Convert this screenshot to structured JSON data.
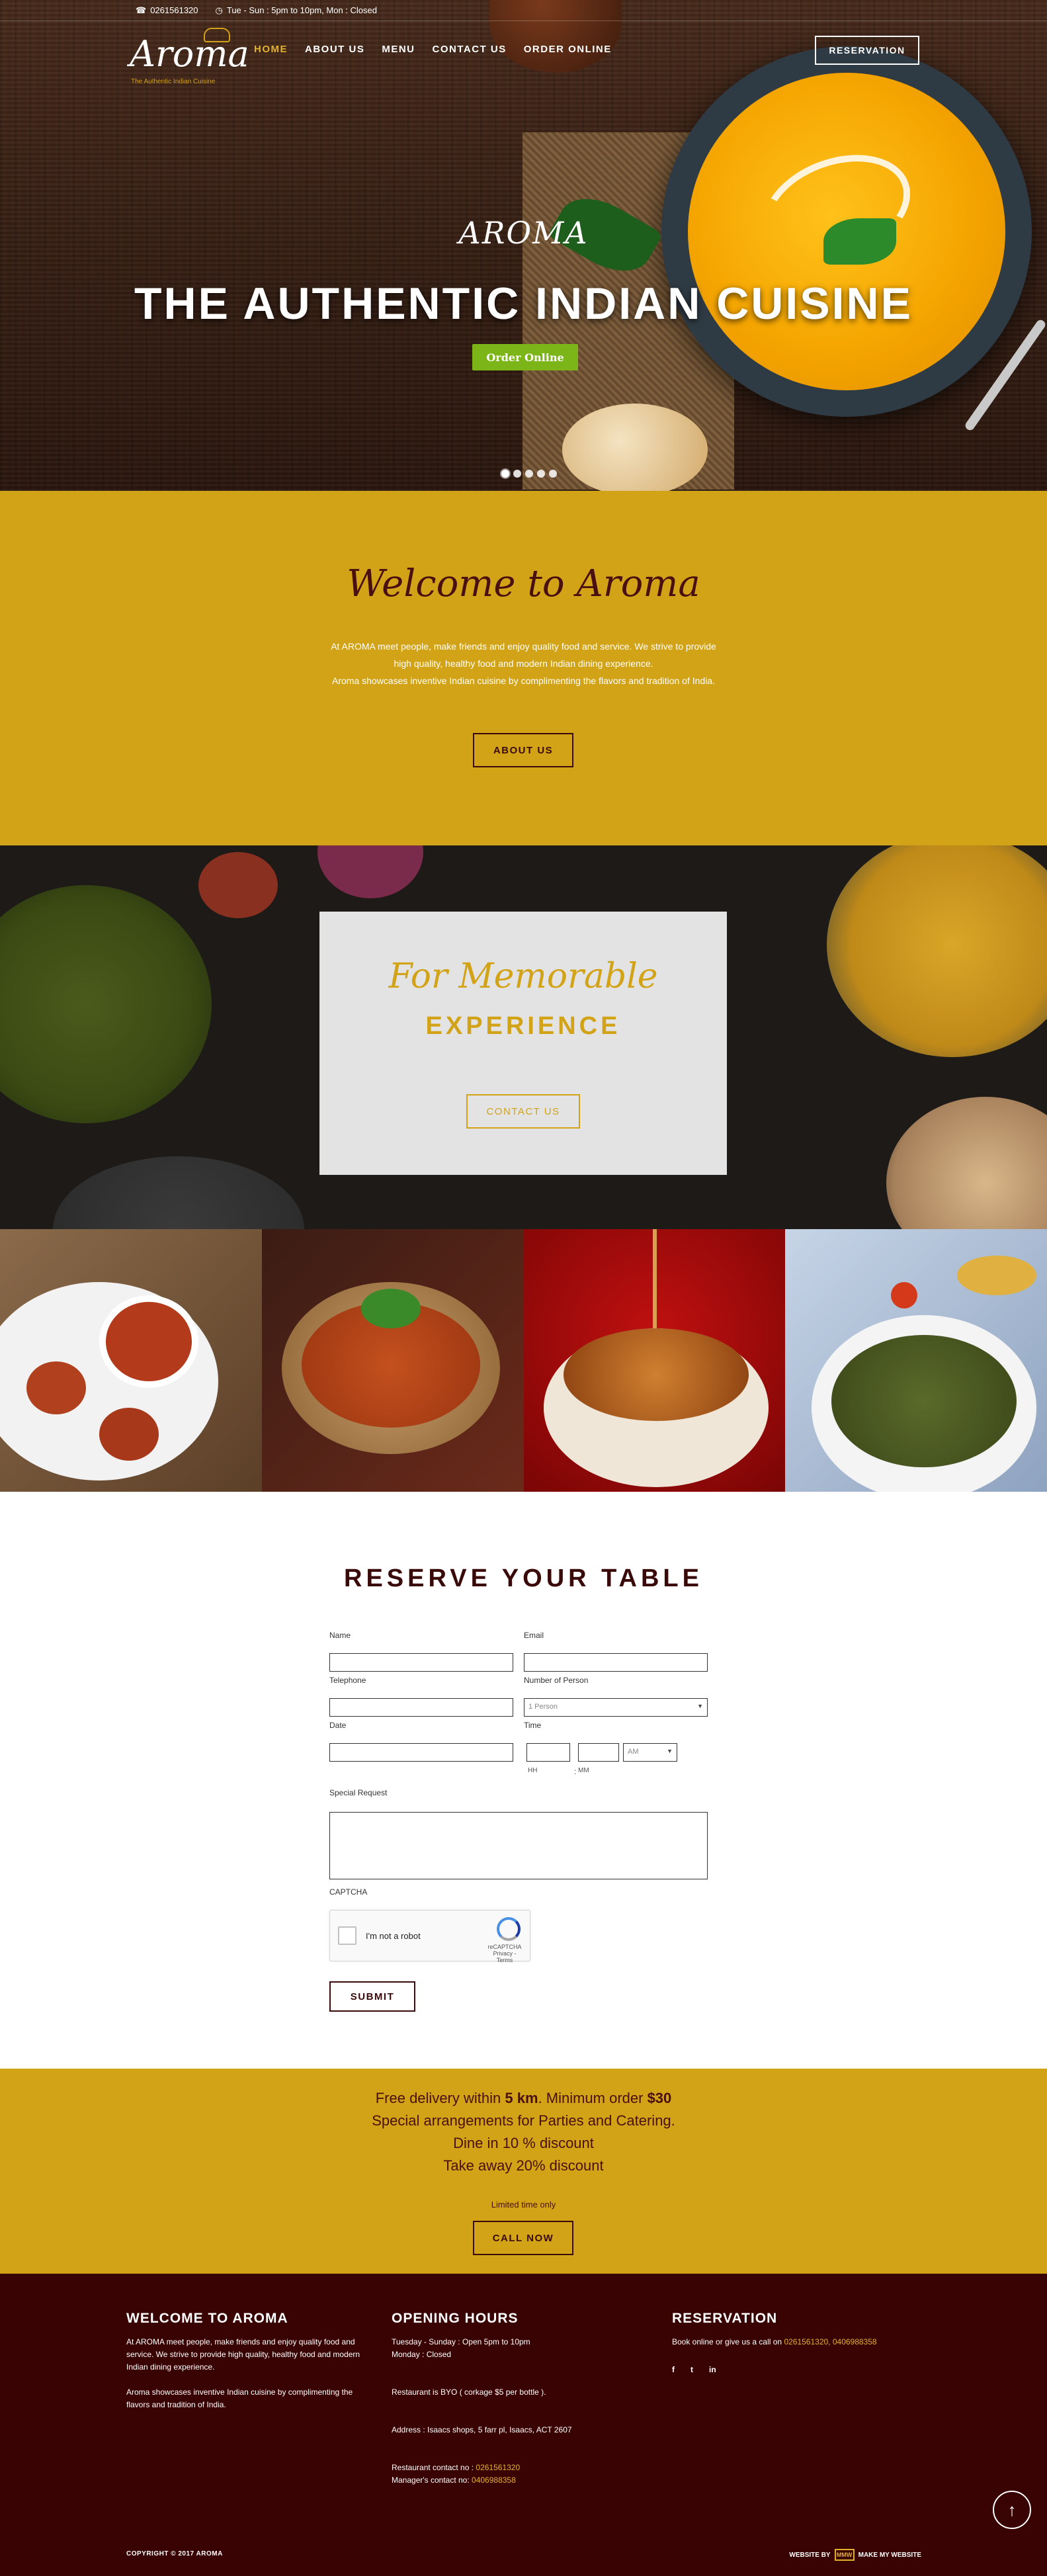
{
  "topbar": {
    "phone": "0261561320",
    "hours": "Tue - Sun : 5pm to 10pm, Mon : Closed"
  },
  "logo": {
    "text": "Aroma",
    "tagline": "The Authentic Indian Cuisine"
  },
  "nav": {
    "items": [
      "HOME",
      "ABOUT US",
      "MENU",
      "CONTACT US",
      "ORDER ONLINE"
    ],
    "reservation": "RESERVATION"
  },
  "hero": {
    "subtitle": "AROMA",
    "title": "THE AUTHENTIC INDIAN CUISINE",
    "cta": "Order Online",
    "slides": 5,
    "active_slide": 1
  },
  "welcome": {
    "title": "Welcome to Aroma",
    "para1": "At AROMA meet people, make friends and enjoy quality food and service. We strive to provide high quality, healthy food and modern Indian dining experience.",
    "para2": "Aroma showcases inventive Indian cuisine by complimenting the flavors and tradition of India.",
    "button": "ABOUT US"
  },
  "memorable": {
    "script": "For Memorable",
    "caps": "EXPERIENCE",
    "button": "CONTACT US"
  },
  "reserve": {
    "title": "RESERVE YOUR TABLE",
    "name_label": "Name",
    "email_label": "Email",
    "telephone_label": "Telephone",
    "persons_label": "Number of Person",
    "persons_value": "1 Person",
    "date_label": "Date",
    "time_label": "Time",
    "hh": "HH",
    "mm": "MM",
    "colon": ":",
    "ampm": "AM",
    "request_label": "Special Request",
    "captcha_label": "CAPTCHA",
    "captcha_text": "I'm not a robot",
    "recaptcha": "reCAPTCHA",
    "recaptcha_links": "Privacy - Terms",
    "submit": "SUBMIT"
  },
  "promo": {
    "l1_pre": "Free delivery within ",
    "l1_b1": "5 km",
    "l1_mid": ". Minimum order ",
    "l1_b2": "$30",
    "l2": "Special arrangements for Parties and Catering.",
    "l3": "Dine in 10 % discount",
    "l4": "Take away 20% discount",
    "note": "Limited time only",
    "button": "CALL NOW"
  },
  "footer": {
    "c1_title": "WELCOME TO AROMA",
    "c1_p1": "At AROMA meet people, make friends and enjoy quality food and service. We strive to provide high quality, healthy food and modern Indian dining experience.",
    "c1_p2": "Aroma showcases inventive Indian cuisine by complimenting the flavors and tradition of India.",
    "c2_title": "OPENING HOURS",
    "c2_l1": "Tuesday - Sunday : Open 5pm to 10pm",
    "c2_l2": "Monday : Closed",
    "c2_l3": "Restaurant is BYO ( corkage $5 per bottle ).",
    "c2_addr": "Address : Isaacs shops, 5 farr pl, Isaacs, ACT 2607",
    "c2_contact_label": "Restaurant contact no : ",
    "c2_contact": "0261561320",
    "c2_manager_label": "Manager's contact no: ",
    "c2_manager": "0406988358",
    "c3_title": "RESERVATION",
    "c3_text": "Book online or give us a call on ",
    "c3_phones": "0261561320, 0406988358",
    "social": [
      "f",
      "t",
      "in"
    ],
    "copyright": "COPYRIGHT © 2017 AROMA",
    "credit_pre": "WEBSITE BY",
    "credit_logo": "MMW",
    "credit_post": "MAKE MY WEBSITE"
  },
  "colors": {
    "gold": "#d3a317",
    "maroon": "#3a0303",
    "green": "#7cb518"
  }
}
